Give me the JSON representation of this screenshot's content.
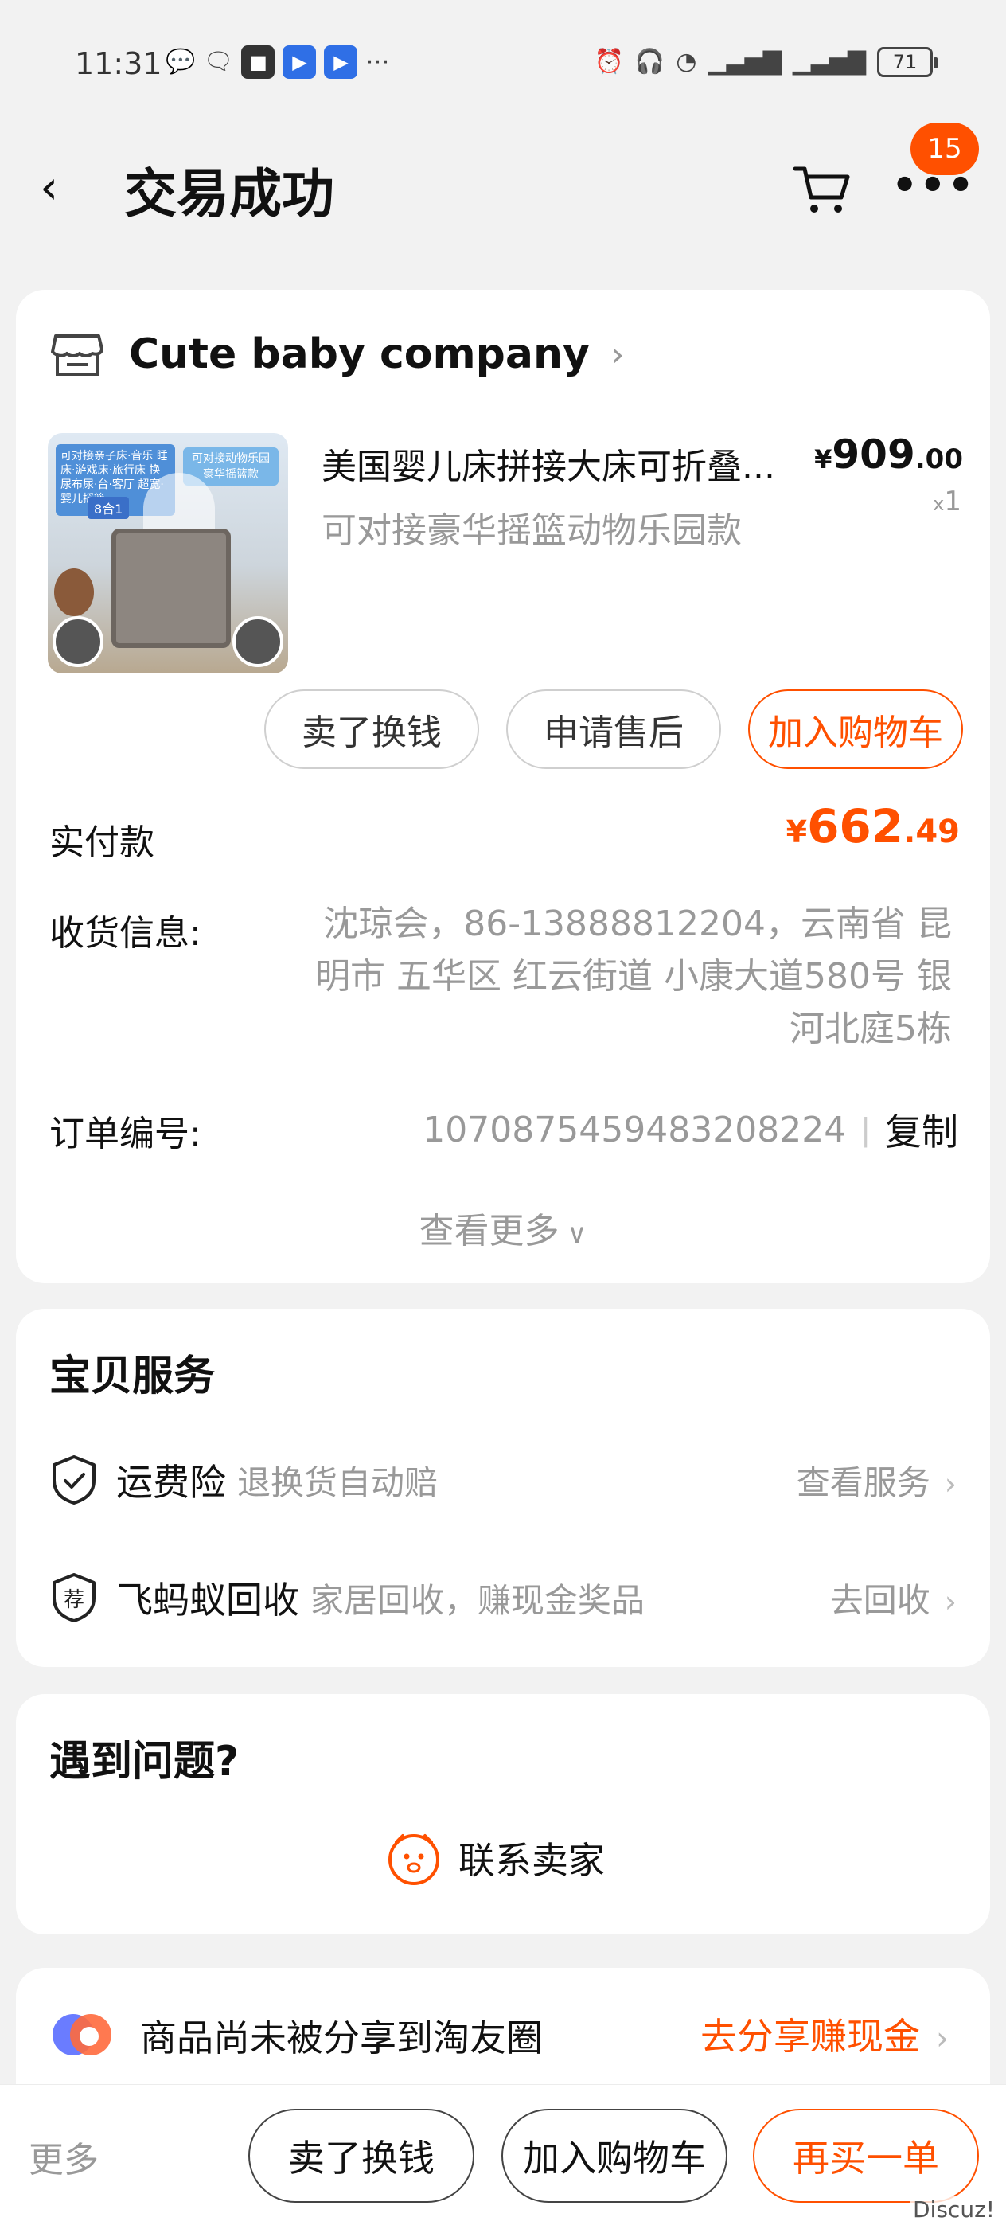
{
  "status_bar": {
    "time": "11:31",
    "battery": "71"
  },
  "nav": {
    "title": "交易成功",
    "badge_count": "15"
  },
  "order": {
    "shop_name": "Cute baby company",
    "product": {
      "title": "美国婴儿床拼接大床可折叠...",
      "sku": "可对接豪华摇篮动物乐园款",
      "price_currency": "¥",
      "price_int": "909",
      "price_dec": ".00",
      "qty_prefix": "x",
      "qty": "1",
      "image_text": {
        "label1": "可对接亲子床·音乐 睡床·游戏床·旅行床 换尿布尿·台·客厅 超宽·婴儿摇篮",
        "label2": "可对接动物乐园 豪华摇篮款",
        "tag": "8合1"
      }
    },
    "actions": {
      "sell": "卖了换钱",
      "aftersale": "申请售后",
      "add_cart": "加入购物车"
    },
    "paid_label": "实付款",
    "paid_currency": "¥",
    "paid_int": "662",
    "paid_dec": ".49",
    "address_label": "收货信息:",
    "address_value": "沈琼会，86-13888812204，云南省 昆明市 五华区 红云街道 小康大道580号 银河北庭5栋",
    "order_no_label": "订单编号:",
    "order_no_value": "1070875459483208224",
    "order_sep": "|",
    "copy_label": "复制",
    "view_more": "查看更多"
  },
  "services": {
    "title": "宝贝服务",
    "items": [
      {
        "name": "运费险",
        "desc": "退换货自动赔",
        "link": "查看服务"
      },
      {
        "name": "飞蚂蚁回收",
        "desc": "家居回收，赚现金奖品",
        "link": "去回收",
        "icon_char": "荐"
      }
    ]
  },
  "issue": {
    "title": "遇到问题?",
    "contact": "联系卖家"
  },
  "share": {
    "text": "商品尚未被分享到淘友圈",
    "link": "去分享赚现金"
  },
  "bottom_bar": {
    "more": "更多",
    "sell": "卖了换钱",
    "add_cart": "加入购物车",
    "rebuy": "再买一单"
  },
  "watermark": "Discuz!",
  "colors": {
    "accent": "#ff5000",
    "muted": "#999999",
    "background": "#f2f2f2"
  }
}
